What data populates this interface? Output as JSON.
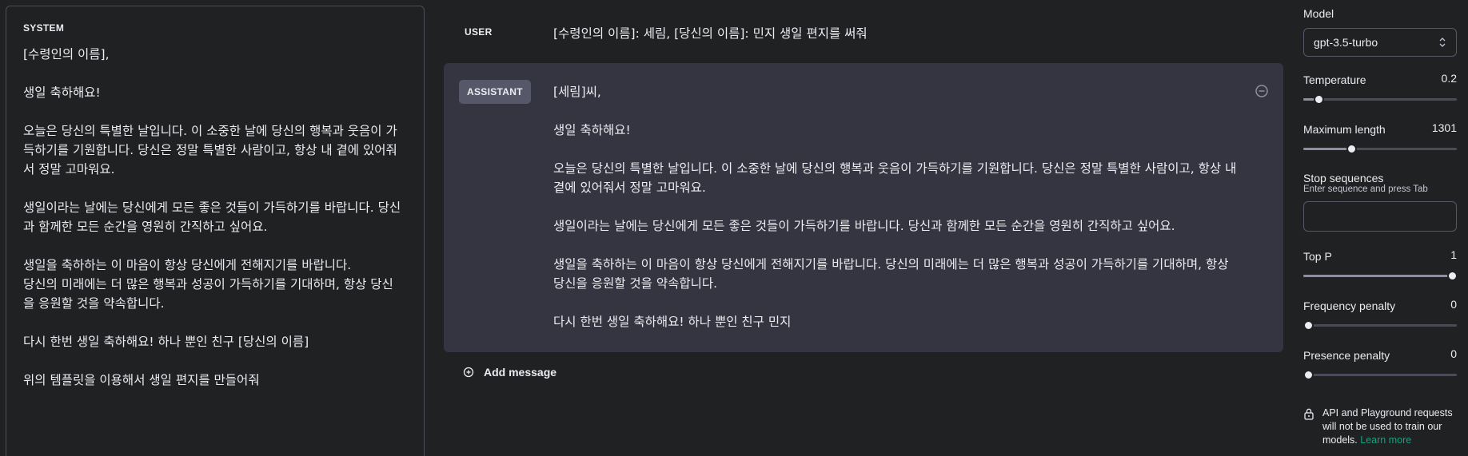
{
  "system": {
    "label": "SYSTEM",
    "text": "[수령인의 이름],\n\n생일 축하해요!\n\n오늘은 당신의 특별한 날입니다. 이 소중한 날에 당신의 행복과 웃음이 가득하기를 기원합니다. 당신은 정말 특별한 사람이고, 항상 내 곁에 있어줘서 정말 고마워요.\n\n생일이라는 날에는 당신에게 모든 좋은 것들이 가득하기를 바랍니다. 당신과 함께한 모든 순간을 영원히 간직하고 싶어요.\n\n생일을 축하하는 이 마음이 항상 당신에게 전해지기를 바랍니다.\n당신의 미래에는 더 많은 행복과 성공이 가득하기를 기대하며, 항상 당신을 응원할 것을 약속합니다.\n\n다시 한번 생일 축하해요! 하나 뿐인 친구 [당신의 이름]\n\n위의 템플릿을 이용해서 생일 편지를 만들어줘"
  },
  "messages": {
    "user": {
      "role": "USER",
      "text": "[수령인의 이름]: 세림, [당신의 이름]: 민지 생일 편지를 써줘"
    },
    "assistant": {
      "role": "ASSISTANT",
      "text": "[세림]씨,\n\n생일 축하해요!\n\n오늘은 당신의 특별한 날입니다. 이 소중한 날에 당신의 행복과 웃음이 가득하기를 기원합니다. 당신은 정말 특별한 사람이고, 항상 내 곁에 있어줘서 정말 고마워요.\n\n생일이라는 날에는 당신에게 모든 좋은 것들이 가득하기를 바랍니다. 당신과 함께한 모든 순간을 영원히 간직하고 싶어요.\n\n생일을 축하하는 이 마음이 항상 당신에게 전해지기를 바랍니다. 당신의 미래에는 더 많은 행복과 성공이 가득하기를 기대하며, 항상 당신을 응원할 것을 약속합니다.\n\n다시 한번 생일 축하해요! 하나 뿐인 친구 민지"
    },
    "add_message_label": "Add message"
  },
  "settings": {
    "model": {
      "label": "Model",
      "value": "gpt-3.5-turbo"
    },
    "temperature": {
      "label": "Temperature",
      "value": "0.2",
      "fraction": 0.1
    },
    "max_length": {
      "label": "Maximum length",
      "value": "1301",
      "fraction": 0.31
    },
    "stop_sequences": {
      "label": "Stop sequences",
      "hint": "Enter sequence and press Tab",
      "value": ""
    },
    "top_p": {
      "label": "Top P",
      "value": "1",
      "fraction": 1.0
    },
    "frequency_penalty": {
      "label": "Frequency penalty",
      "value": "0",
      "fraction": 0.0
    },
    "presence_penalty": {
      "label": "Presence penalty",
      "value": "0",
      "fraction": 0.0
    },
    "notice": {
      "text": "API and Playground requests will not be used to train our models.",
      "link": "Learn more"
    }
  },
  "colors": {
    "background": "#202123",
    "assistant_bg": "#343541",
    "accent": "#10a37f"
  }
}
